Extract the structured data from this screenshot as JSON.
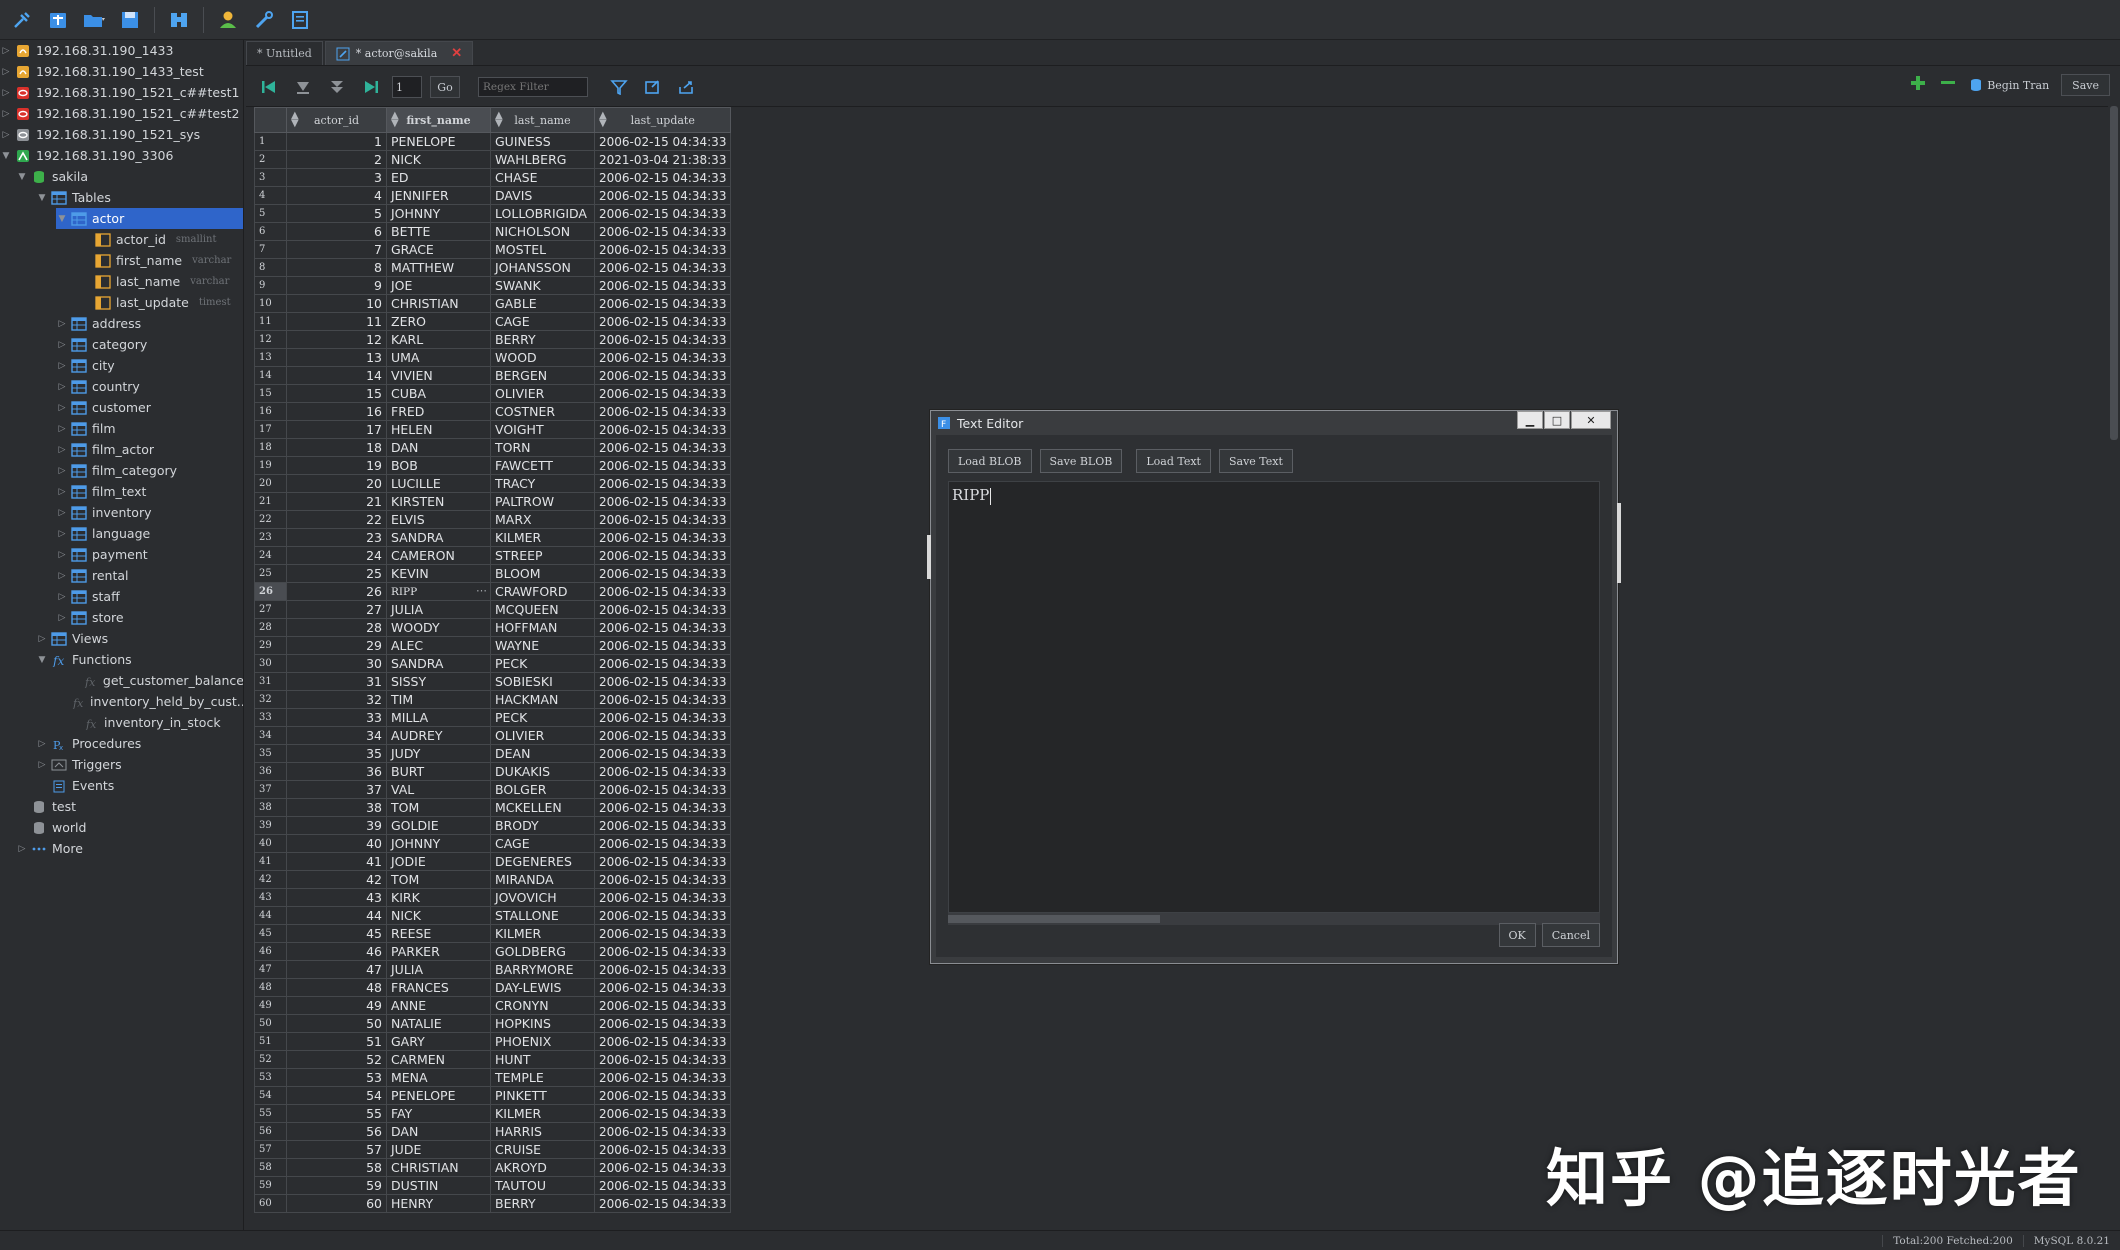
{
  "toolbar": {
    "icons": [
      "connect-icon",
      "new-query-icon",
      "open-icon",
      "save-icon",
      "find-icon",
      "user-icon",
      "tools-icon",
      "notes-icon"
    ]
  },
  "sidebar": {
    "connections": [
      {
        "label": "192.168.31.190_1433",
        "icon": "sqlserver-icon"
      },
      {
        "label": "192.168.31.190_1433_test",
        "icon": "sqlserver-icon"
      },
      {
        "label": "192.168.31.190_1521_c##test1",
        "icon": "oracle-icon"
      },
      {
        "label": "192.168.31.190_1521_c##test2",
        "icon": "oracle-icon"
      },
      {
        "label": "192.168.31.190_1521_sys",
        "icon": "oracle-disabled-icon"
      },
      {
        "label": "192.168.31.190_3306",
        "icon": "mysql-icon"
      }
    ],
    "db_sakila": "sakila",
    "tables_label": "Tables",
    "actor_label": "actor",
    "columns": [
      {
        "name": "actor_id",
        "type": "smallint"
      },
      {
        "name": "first_name",
        "type": "varchar"
      },
      {
        "name": "last_name",
        "type": "varchar"
      },
      {
        "name": "last_update",
        "type": "timest"
      }
    ],
    "tables": [
      "address",
      "category",
      "city",
      "country",
      "customer",
      "film",
      "film_actor",
      "film_category",
      "film_text",
      "inventory",
      "language",
      "payment",
      "rental",
      "staff",
      "store"
    ],
    "views_label": "Views",
    "functions_label": "Functions",
    "functions": [
      "get_customer_balance",
      "inventory_held_by_cust...",
      "inventory_in_stock"
    ],
    "procedures_label": "Procedures",
    "triggers_label": "Triggers",
    "events_label": "Events",
    "db_test": "test",
    "db_world": "world",
    "more_label": "More"
  },
  "tabs": [
    {
      "label": "* Untitled"
    },
    {
      "label": "* actor@sakila"
    }
  ],
  "grid_toolbar": {
    "page_value": "1",
    "go_label": "Go",
    "regex_placeholder": "Regex Filter",
    "begin_tran_label": "Begin Tran",
    "save_label": "Save"
  },
  "grid": {
    "columns": [
      "actor_id",
      "first_name",
      "last_name",
      "last_update"
    ],
    "selected_row": 26,
    "rows": [
      [
        1,
        "PENELOPE",
        "GUINESS",
        "2006-02-15 04:34:33"
      ],
      [
        2,
        "NICK",
        "WAHLBERG",
        "2021-03-04 21:38:33"
      ],
      [
        3,
        "ED",
        "CHASE",
        "2006-02-15 04:34:33"
      ],
      [
        4,
        "JENNIFER",
        "DAVIS",
        "2006-02-15 04:34:33"
      ],
      [
        5,
        "JOHNNY",
        "LOLLOBRIGIDA",
        "2006-02-15 04:34:33"
      ],
      [
        6,
        "BETTE",
        "NICHOLSON",
        "2006-02-15 04:34:33"
      ],
      [
        7,
        "GRACE",
        "MOSTEL",
        "2006-02-15 04:34:33"
      ],
      [
        8,
        "MATTHEW",
        "JOHANSSON",
        "2006-02-15 04:34:33"
      ],
      [
        9,
        "JOE",
        "SWANK",
        "2006-02-15 04:34:33"
      ],
      [
        10,
        "CHRISTIAN",
        "GABLE",
        "2006-02-15 04:34:33"
      ],
      [
        11,
        "ZERO",
        "CAGE",
        "2006-02-15 04:34:33"
      ],
      [
        12,
        "KARL",
        "BERRY",
        "2006-02-15 04:34:33"
      ],
      [
        13,
        "UMA",
        "WOOD",
        "2006-02-15 04:34:33"
      ],
      [
        14,
        "VIVIEN",
        "BERGEN",
        "2006-02-15 04:34:33"
      ],
      [
        15,
        "CUBA",
        "OLIVIER",
        "2006-02-15 04:34:33"
      ],
      [
        16,
        "FRED",
        "COSTNER",
        "2006-02-15 04:34:33"
      ],
      [
        17,
        "HELEN",
        "VOIGHT",
        "2006-02-15 04:34:33"
      ],
      [
        18,
        "DAN",
        "TORN",
        "2006-02-15 04:34:33"
      ],
      [
        19,
        "BOB",
        "FAWCETT",
        "2006-02-15 04:34:33"
      ],
      [
        20,
        "LUCILLE",
        "TRACY",
        "2006-02-15 04:34:33"
      ],
      [
        21,
        "KIRSTEN",
        "PALTROW",
        "2006-02-15 04:34:33"
      ],
      [
        22,
        "ELVIS",
        "MARX",
        "2006-02-15 04:34:33"
      ],
      [
        23,
        "SANDRA",
        "KILMER",
        "2006-02-15 04:34:33"
      ],
      [
        24,
        "CAMERON",
        "STREEP",
        "2006-02-15 04:34:33"
      ],
      [
        25,
        "KEVIN",
        "BLOOM",
        "2006-02-15 04:34:33"
      ],
      [
        26,
        "RIPP",
        "CRAWFORD",
        "2006-02-15 04:34:33"
      ],
      [
        27,
        "JULIA",
        "MCQUEEN",
        "2006-02-15 04:34:33"
      ],
      [
        28,
        "WOODY",
        "HOFFMAN",
        "2006-02-15 04:34:33"
      ],
      [
        29,
        "ALEC",
        "WAYNE",
        "2006-02-15 04:34:33"
      ],
      [
        30,
        "SANDRA",
        "PECK",
        "2006-02-15 04:34:33"
      ],
      [
        31,
        "SISSY",
        "SOBIESKI",
        "2006-02-15 04:34:33"
      ],
      [
        32,
        "TIM",
        "HACKMAN",
        "2006-02-15 04:34:33"
      ],
      [
        33,
        "MILLA",
        "PECK",
        "2006-02-15 04:34:33"
      ],
      [
        34,
        "AUDREY",
        "OLIVIER",
        "2006-02-15 04:34:33"
      ],
      [
        35,
        "JUDY",
        "DEAN",
        "2006-02-15 04:34:33"
      ],
      [
        36,
        "BURT",
        "DUKAKIS",
        "2006-02-15 04:34:33"
      ],
      [
        37,
        "VAL",
        "BOLGER",
        "2006-02-15 04:34:33"
      ],
      [
        38,
        "TOM",
        "MCKELLEN",
        "2006-02-15 04:34:33"
      ],
      [
        39,
        "GOLDIE",
        "BRODY",
        "2006-02-15 04:34:33"
      ],
      [
        40,
        "JOHNNY",
        "CAGE",
        "2006-02-15 04:34:33"
      ],
      [
        41,
        "JODIE",
        "DEGENERES",
        "2006-02-15 04:34:33"
      ],
      [
        42,
        "TOM",
        "MIRANDA",
        "2006-02-15 04:34:33"
      ],
      [
        43,
        "KIRK",
        "JOVOVICH",
        "2006-02-15 04:34:33"
      ],
      [
        44,
        "NICK",
        "STALLONE",
        "2006-02-15 04:34:33"
      ],
      [
        45,
        "REESE",
        "KILMER",
        "2006-02-15 04:34:33"
      ],
      [
        46,
        "PARKER",
        "GOLDBERG",
        "2006-02-15 04:34:33"
      ],
      [
        47,
        "JULIA",
        "BARRYMORE",
        "2006-02-15 04:34:33"
      ],
      [
        48,
        "FRANCES",
        "DAY-LEWIS",
        "2006-02-15 04:34:33"
      ],
      [
        49,
        "ANNE",
        "CRONYN",
        "2006-02-15 04:34:33"
      ],
      [
        50,
        "NATALIE",
        "HOPKINS",
        "2006-02-15 04:34:33"
      ],
      [
        51,
        "GARY",
        "PHOENIX",
        "2006-02-15 04:34:33"
      ],
      [
        52,
        "CARMEN",
        "HUNT",
        "2006-02-15 04:34:33"
      ],
      [
        53,
        "MENA",
        "TEMPLE",
        "2006-02-15 04:34:33"
      ],
      [
        54,
        "PENELOPE",
        "PINKETT",
        "2006-02-15 04:34:33"
      ],
      [
        55,
        "FAY",
        "KILMER",
        "2006-02-15 04:34:33"
      ],
      [
        56,
        "DAN",
        "HARRIS",
        "2006-02-15 04:34:33"
      ],
      [
        57,
        "JUDE",
        "CRUISE",
        "2006-02-15 04:34:33"
      ],
      [
        58,
        "CHRISTIAN",
        "AKROYD",
        "2006-02-15 04:34:33"
      ],
      [
        59,
        "DUSTIN",
        "TAUTOU",
        "2006-02-15 04:34:33"
      ],
      [
        60,
        "HENRY",
        "BERRY",
        "2006-02-15 04:34:33"
      ]
    ]
  },
  "dialog": {
    "title": "Text Editor",
    "load_blob": "Load BLOB",
    "save_blob": "Save BLOB",
    "load_text": "Load Text",
    "save_text": "Save Text",
    "content": "RIPP",
    "ok": "OK",
    "cancel": "Cancel"
  },
  "status": {
    "counts": "Total:200 Fetched:200",
    "server": "MySQL 8.0.21"
  },
  "watermark": "知乎 @追逐时光者",
  "colors": {
    "background": "#2b2d30",
    "selection": "#2f65ca",
    "table_icon": "#4e9be8",
    "column_icon": "#e7a633",
    "add": "#3db04a",
    "remove": "#3db04a"
  }
}
